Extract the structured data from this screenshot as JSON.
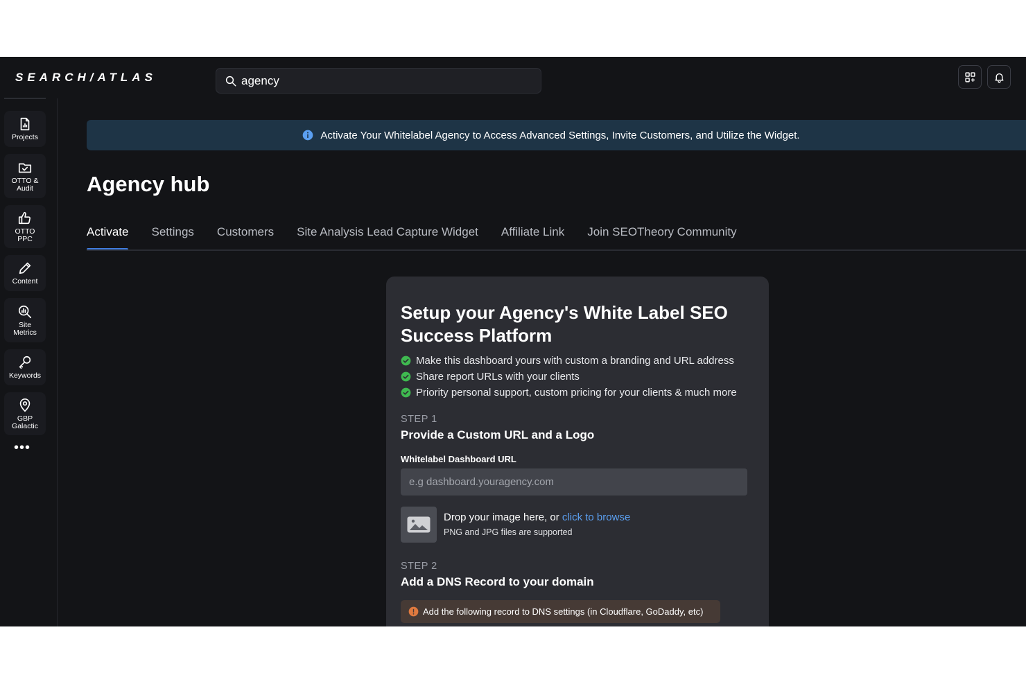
{
  "app": {
    "logo": "SEARCH/ATLAS"
  },
  "search": {
    "value": "agency"
  },
  "sidebar": {
    "items": [
      {
        "label": "Projects",
        "icon": "document-icon"
      },
      {
        "label": "OTTO & Audit",
        "icon": "folder-check-icon"
      },
      {
        "label": "OTTO PPC",
        "icon": "thumbs-up-icon"
      },
      {
        "label": "Content",
        "icon": "pencil-icon"
      },
      {
        "label": "Site Metrics",
        "icon": "chart-search-icon"
      },
      {
        "label": "Keywords",
        "icon": "key-icon"
      },
      {
        "label": "GBP Galactic",
        "icon": "location-pin-icon"
      }
    ],
    "more": "•••"
  },
  "banner": {
    "text": "Activate Your Whitelabel Agency to Access Advanced Settings, Invite Customers, and Utilize the Widget."
  },
  "page": {
    "title": "Agency hub"
  },
  "tabs": [
    {
      "label": "Activate",
      "active": true
    },
    {
      "label": "Settings"
    },
    {
      "label": "Customers"
    },
    {
      "label": "Site Analysis Lead Capture Widget"
    },
    {
      "label": "Affiliate Link"
    },
    {
      "label": "Join SEOTheory Community"
    }
  ],
  "card": {
    "title": "Setup your Agency's White Label SEO Success Platform",
    "features": [
      "Make this dashboard yours with custom a branding and URL address",
      "Share report URLs with your clients",
      "Priority personal support, custom pricing for your clients & much more"
    ],
    "step1": {
      "label": "STEP 1",
      "title": "Provide a Custom URL and a Logo",
      "field_label": "Whitelabel Dashboard URL",
      "url_placeholder": "e.g dashboard.youragency.com",
      "drop_text": "Drop your image here, or",
      "drop_link": "click to browse",
      "drop_sub": "PNG and JPG files are supported"
    },
    "step2": {
      "label": "STEP 2",
      "title": "Add a DNS Record to your domain",
      "note": "Add the following record to DNS settings (in Cloudflare, GoDaddy, etc)"
    }
  },
  "colors": {
    "background": "#131417",
    "accent": "#3f7de0",
    "banner": "#1e3446",
    "card": "#2c2d33",
    "success": "#3fb950",
    "warning": "#e07a3f",
    "link": "#5b9ff0"
  }
}
